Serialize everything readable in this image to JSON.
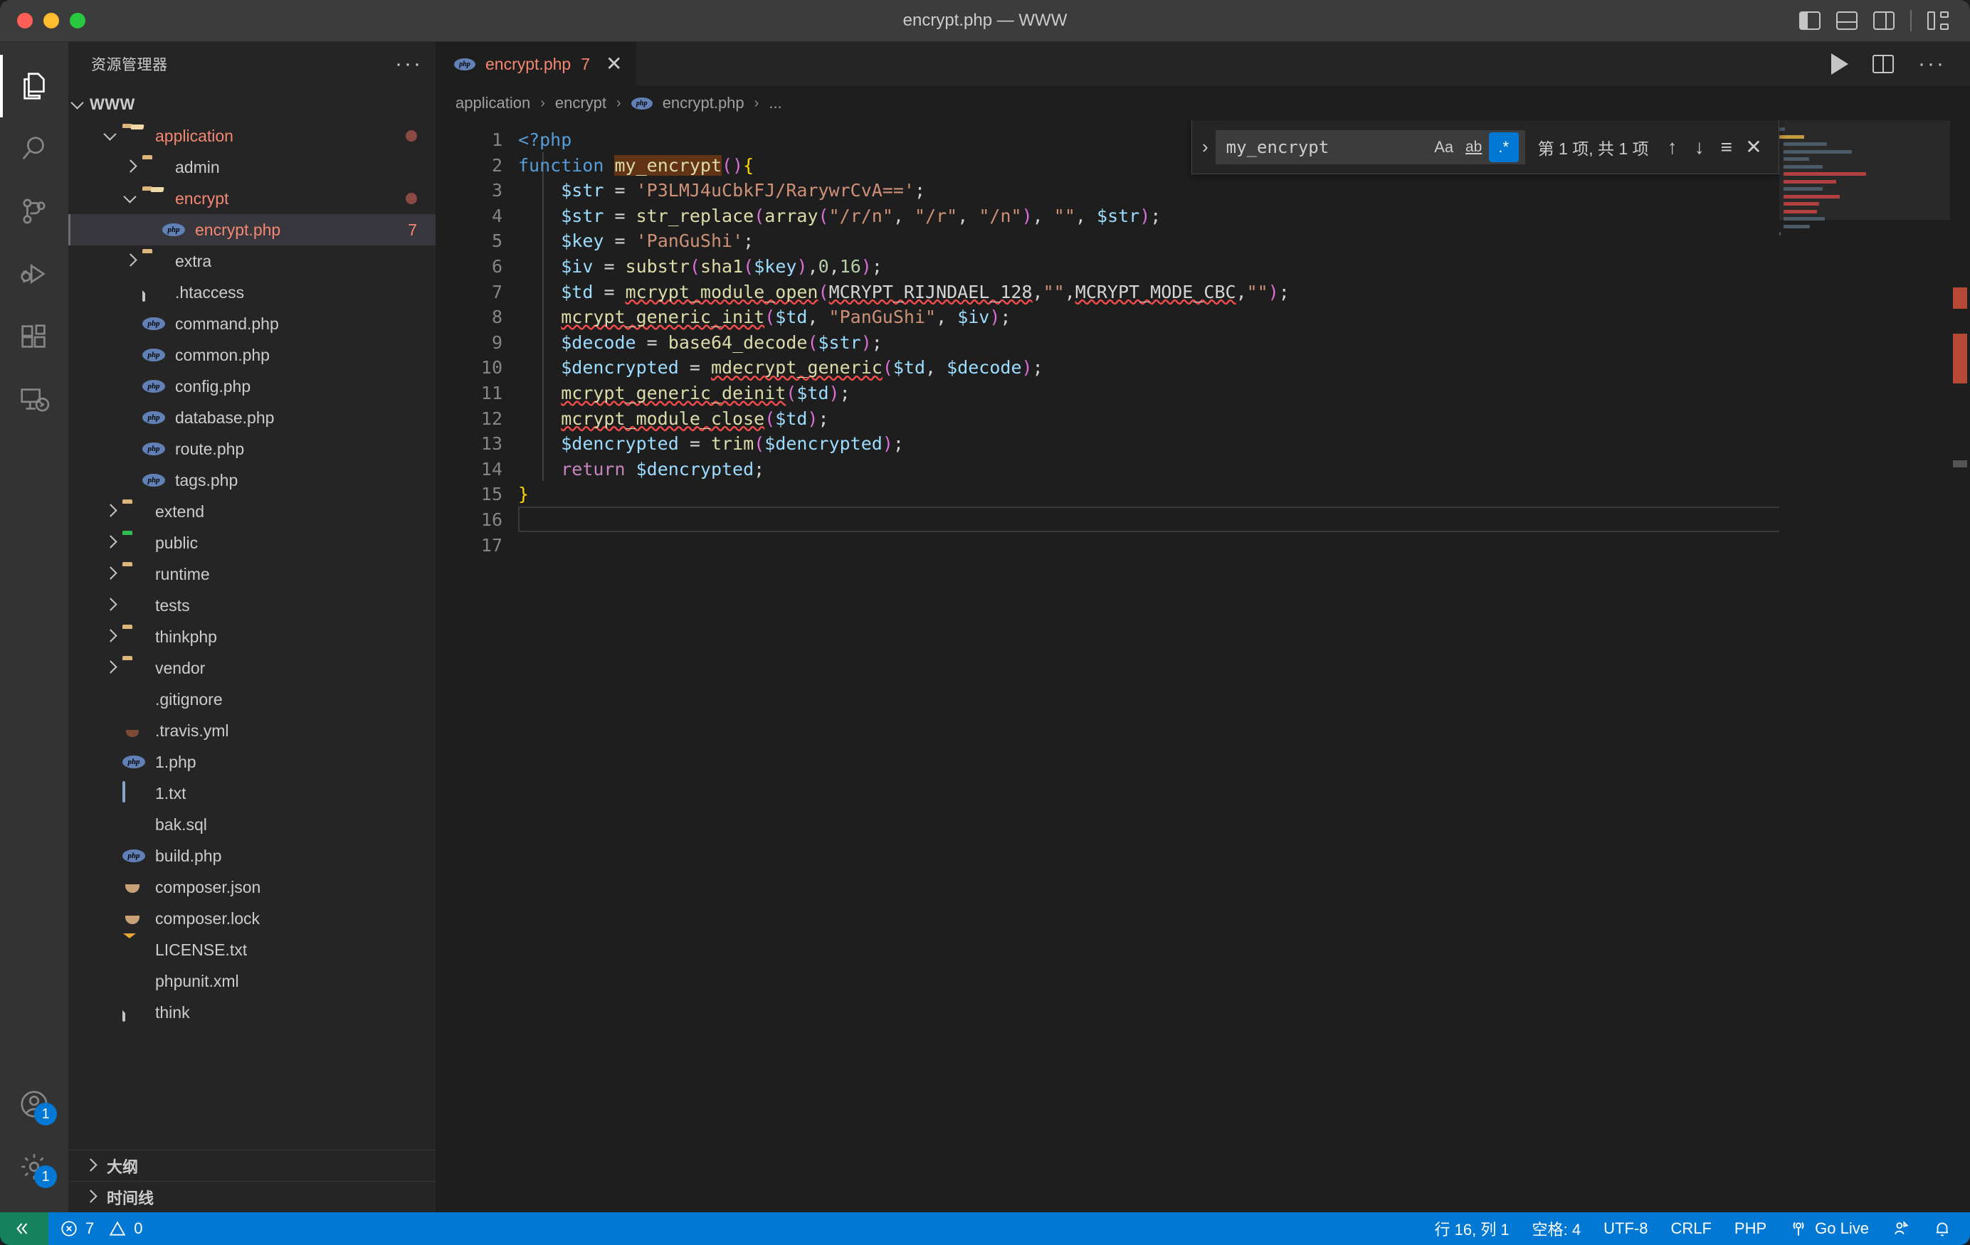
{
  "window": {
    "title": "encrypt.php — WWW",
    "layout_icons": [
      "panel-left-icon",
      "panel-bottom-icon",
      "panel-right-icon",
      "customize-layout-icon"
    ]
  },
  "activitybar": {
    "items": [
      {
        "name": "explorer",
        "icon": "files-icon",
        "active": true
      },
      {
        "name": "search",
        "icon": "search-icon",
        "active": false
      },
      {
        "name": "source-control",
        "icon": "source-control-icon",
        "active": false
      },
      {
        "name": "run-and-debug",
        "icon": "debug-icon",
        "active": false
      },
      {
        "name": "extensions",
        "icon": "extensions-icon",
        "active": false
      },
      {
        "name": "remote-explorer",
        "icon": "remote-icon",
        "active": false
      }
    ],
    "bottom": [
      {
        "name": "accounts",
        "icon": "account-icon",
        "badge": "1"
      },
      {
        "name": "manage",
        "icon": "gear-icon",
        "badge": "1"
      }
    ]
  },
  "sidebar": {
    "title": "资源管理器",
    "more_actions": "···",
    "root": "WWW",
    "tree": [
      {
        "label": "application",
        "icon": "folder-open-icon",
        "depth": 1,
        "chev": "open",
        "color": "err",
        "modified": true
      },
      {
        "label": "admin",
        "icon": "folder-icon",
        "depth": 2,
        "chev": "closed"
      },
      {
        "label": "encrypt",
        "icon": "folder-open-icon",
        "depth": 2,
        "chev": "open",
        "color": "err",
        "modified": true
      },
      {
        "label": "encrypt.php",
        "icon": "php-icon",
        "depth": 3,
        "chev": "none",
        "color": "err",
        "count": "7",
        "selected": true
      },
      {
        "label": "extra",
        "icon": "folder-icon",
        "depth": 2,
        "chev": "closed"
      },
      {
        "label": ".htaccess",
        "icon": "file-icon",
        "depth": 2,
        "chev": "none"
      },
      {
        "label": "command.php",
        "icon": "php-icon",
        "depth": 2,
        "chev": "none"
      },
      {
        "label": "common.php",
        "icon": "php-icon",
        "depth": 2,
        "chev": "none"
      },
      {
        "label": "config.php",
        "icon": "php-icon",
        "depth": 2,
        "chev": "none"
      },
      {
        "label": "database.php",
        "icon": "php-icon",
        "depth": 2,
        "chev": "none"
      },
      {
        "label": "route.php",
        "icon": "php-icon",
        "depth": 2,
        "chev": "none"
      },
      {
        "label": "tags.php",
        "icon": "php-icon",
        "depth": 2,
        "chev": "none"
      },
      {
        "label": "extend",
        "icon": "folder-icon",
        "depth": 1,
        "chev": "closed"
      },
      {
        "label": "public",
        "icon": "folder-public-icon",
        "depth": 1,
        "chev": "closed"
      },
      {
        "label": "runtime",
        "icon": "folder-icon",
        "depth": 1,
        "chev": "closed"
      },
      {
        "label": "tests",
        "icon": "folder-test-icon",
        "depth": 1,
        "chev": "closed"
      },
      {
        "label": "thinkphp",
        "icon": "folder-icon",
        "depth": 1,
        "chev": "closed"
      },
      {
        "label": "vendor",
        "icon": "folder-icon",
        "depth": 1,
        "chev": "closed"
      },
      {
        "label": ".gitignore",
        "icon": "git-icon",
        "depth": 1,
        "chev": "none"
      },
      {
        "label": ".travis.yml",
        "icon": "travis-icon",
        "depth": 1,
        "chev": "none"
      },
      {
        "label": "1.php",
        "icon": "php-icon",
        "depth": 1,
        "chev": "none"
      },
      {
        "label": "1.txt",
        "icon": "text-icon",
        "depth": 1,
        "chev": "none"
      },
      {
        "label": "bak.sql",
        "icon": "database-icon",
        "depth": 1,
        "chev": "none"
      },
      {
        "label": "build.php",
        "icon": "php-icon",
        "depth": 1,
        "chev": "none"
      },
      {
        "label": "composer.json",
        "icon": "composer-icon",
        "depth": 1,
        "chev": "none"
      },
      {
        "label": "composer.lock",
        "icon": "composer-icon",
        "depth": 1,
        "chev": "none"
      },
      {
        "label": "LICENSE.txt",
        "icon": "license-icon",
        "depth": 1,
        "chev": "none"
      },
      {
        "label": "phpunit.xml",
        "icon": "xml-icon",
        "depth": 1,
        "chev": "none"
      },
      {
        "label": "think",
        "icon": "file-icon",
        "depth": 1,
        "chev": "none"
      }
    ],
    "sections": [
      {
        "label": "大纲",
        "icon": "chevron-right-icon"
      },
      {
        "label": "时间线",
        "icon": "chevron-right-icon"
      }
    ]
  },
  "editor": {
    "tab": {
      "label": "encrypt.php",
      "icon": "php-icon",
      "problem_count": "7",
      "close": "✕"
    },
    "actions": [
      "run-icon",
      "split-editor-icon",
      "more-actions-icon"
    ],
    "breadcrumb": [
      "application",
      "encrypt",
      "encrypt.php",
      "..."
    ],
    "breadcrumb_sep": "›",
    "line_numbers": [
      "1",
      "2",
      "3",
      "4",
      "5",
      "6",
      "7",
      "8",
      "9",
      "10",
      "11",
      "12",
      "13",
      "14",
      "15",
      "16",
      "17"
    ],
    "code_lines": [
      "<?php",
      "function my_encrypt(){",
      "    $str = 'P3LMJ4uCbkFJ/RarywrCvA==';",
      "    $str = str_replace(array(\"/r/n\", \"/r\", \"/n\"), \"\", $str);",
      "    $key = 'PanGuShi';",
      "    $iv = substr(sha1($key),0,16);",
      "    $td = mcrypt_module_open(MCRYPT_RIJNDAEL_128,\"\",MCRYPT_MODE_CBC,\"\");",
      "    mcrypt_generic_init($td, \"PanGuShi\", $iv);",
      "    $decode = base64_decode($str);",
      "    $dencrypted = mdecrypt_generic($td, $decode);",
      "    mcrypt_generic_deinit($td);",
      "    mcrypt_module_close($td);",
      "    $dencrypted = trim($dencrypted);",
      "    return $dencrypted;",
      "}",
      "",
      ""
    ]
  },
  "find": {
    "expand_icon": "chevron-right-icon",
    "query": "my_encrypt",
    "match_case_label": "Aa",
    "whole_word_label": "ab",
    "regex_label": ".*",
    "regex_active": true,
    "result_count": "第 1 项, 共 1 项",
    "prev_icon": "arrow-up-icon",
    "next_icon": "arrow-down-icon",
    "selection_icon": "find-in-selection-icon",
    "close_icon": "✕"
  },
  "statusbar": {
    "remote_icon": "remote-window-icon",
    "errors_icon": "error-icon",
    "errors": "7",
    "warnings_icon": "warning-icon",
    "warnings": "0",
    "cursor_position": "行 16, 列 1",
    "indentation": "空格: 4",
    "encoding": "UTF-8",
    "eol": "CRLF",
    "language": "PHP",
    "go_live": "Go Live",
    "go_live_icon": "broadcast-icon",
    "feedback_icon": "feedback-icon",
    "bell_icon": "bell-icon"
  },
  "colors": {
    "accent": "#0078d4",
    "remote_green": "#16825d",
    "error_red": "#f48771",
    "titlebar": "#3c3c3c",
    "sidebar_bg": "#252526",
    "editor_bg": "#1e1e1e"
  }
}
